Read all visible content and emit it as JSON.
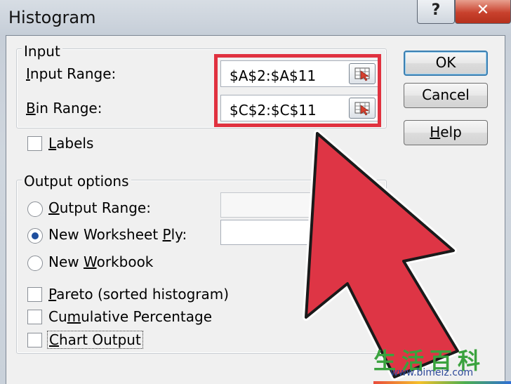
{
  "window": {
    "title": "Histogram",
    "help_glyph": "?",
    "close_glyph": "✕"
  },
  "input_group": {
    "label": "Input",
    "input_range": {
      "label_prefix": "",
      "label_mnemonic": "I",
      "label_rest": "nput Range:",
      "value": "$A$2:$A$11"
    },
    "bin_range": {
      "label_mnemonic": "B",
      "label_rest": "in Range:",
      "value": "$C$2:$C$11"
    }
  },
  "labels_checkbox": {
    "mnemonic": "L",
    "rest": "abels",
    "checked": false
  },
  "output_group": {
    "label": "Output options",
    "output_range": {
      "mnemonic": "O",
      "rest": "utput Range:",
      "selected": false,
      "value": ""
    },
    "new_worksheet": {
      "pre": "New Worksheet ",
      "mnemonic": "P",
      "rest": "ly:",
      "selected": true,
      "value": ""
    },
    "new_workbook": {
      "pre": "New ",
      "mnemonic": "W",
      "rest": "orkbook",
      "selected": false
    }
  },
  "options": {
    "pareto": {
      "mnemonic": "P",
      "rest": "areto (sorted histogram)",
      "checked": false
    },
    "cumulative": {
      "pre": "Cu",
      "mnemonic": "m",
      "rest": "ulative Percentage",
      "checked": false
    },
    "chart": {
      "mnemonic": "C",
      "rest": "hart Output",
      "checked": false
    }
  },
  "buttons": {
    "ok": "OK",
    "cancel": "Cancel",
    "help_mnemonic": "H",
    "help_rest": "elp"
  },
  "icons": {
    "range_picker": "collapse-dialog-icon",
    "annotation_cursor": "red-arrow-cursor-icon"
  },
  "colors": {
    "highlight": "#e0313f",
    "radio_selected": "#1f4f9e",
    "close_button": "#c8412d"
  },
  "watermark": {
    "chars": "生活百科",
    "url": "www.bimeiz.com"
  }
}
